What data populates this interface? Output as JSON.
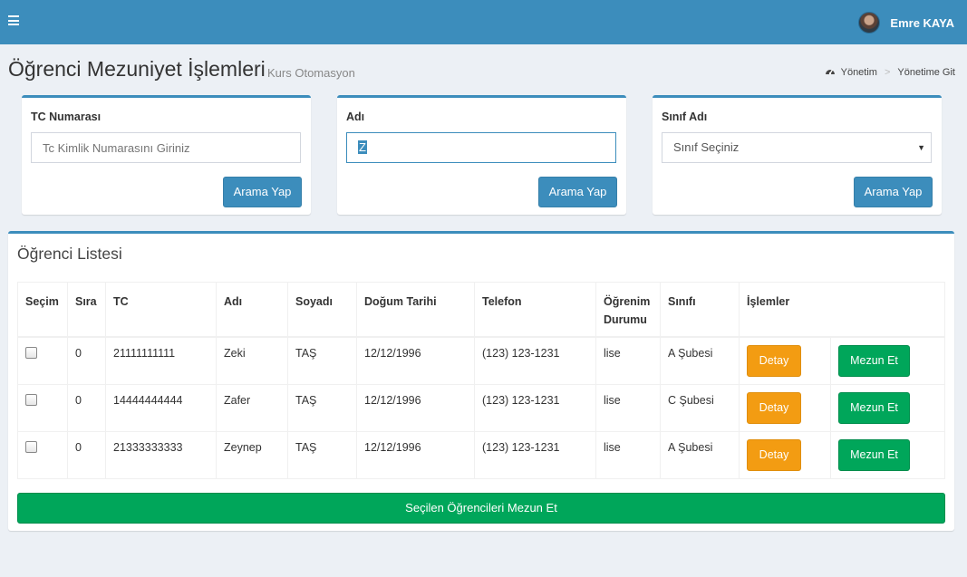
{
  "header": {
    "menu_icon": "hamburger-icon",
    "user_name": "Emre KAYA",
    "brand_color": "#3c8dbc"
  },
  "page": {
    "title": "Öğrenci Mezuniyet İşlemleri",
    "subtitle": "Kurs Otomasyon"
  },
  "breadcrumb": {
    "icon": "dashboard-icon",
    "items": [
      "Yönetim",
      "Yönetime Git"
    ]
  },
  "search": {
    "tc": {
      "label": "TC Numarası",
      "placeholder": "Tc Kimlik Numarasını Giriniz",
      "value": "",
      "button": "Arama Yap"
    },
    "name": {
      "label": "Adı",
      "value": "Z",
      "button": "Arama Yap"
    },
    "class": {
      "label": "Sınıf Adı",
      "selected": "Sınıf Seçiniz",
      "button": "Arama Yap"
    }
  },
  "list": {
    "title": "Öğrenci Listesi",
    "columns": [
      "Seçim",
      "Sıra",
      "TC",
      "Adı",
      "Soyadı",
      "Doğum Tarihi",
      "Telefon",
      "Öğrenim Durumu",
      "Sınıfı",
      "İşlemler"
    ],
    "rows": [
      {
        "sira": "0",
        "tc": "21111111111",
        "adi": "Zeki",
        "soyadi": "TAŞ",
        "dogum": "12/12/1996",
        "telefon": "(123) 123-1231",
        "ogrenim": "lise",
        "sinif": "A Şubesi",
        "detay": "Detay",
        "mezun": "Mezun Et"
      },
      {
        "sira": "0",
        "tc": "14444444444",
        "adi": "Zafer",
        "soyadi": "TAŞ",
        "dogum": "12/12/1996",
        "telefon": "(123) 123-1231",
        "ogrenim": "lise",
        "sinif": "C Şubesi",
        "detay": "Detay",
        "mezun": "Mezun Et"
      },
      {
        "sira": "0",
        "tc": "21333333333",
        "adi": "Zeynep",
        "soyadi": "TAŞ",
        "dogum": "12/12/1996",
        "telefon": "(123) 123-1231",
        "ogrenim": "lise",
        "sinif": "A Şubesi",
        "detay": "Detay",
        "mezun": "Mezun Et"
      }
    ],
    "bulk_button": "Seçilen Öğrencileri Mezun Et"
  },
  "colors": {
    "warning": "#f39c12",
    "success": "#00a65a",
    "background": "#ecf0f5"
  }
}
